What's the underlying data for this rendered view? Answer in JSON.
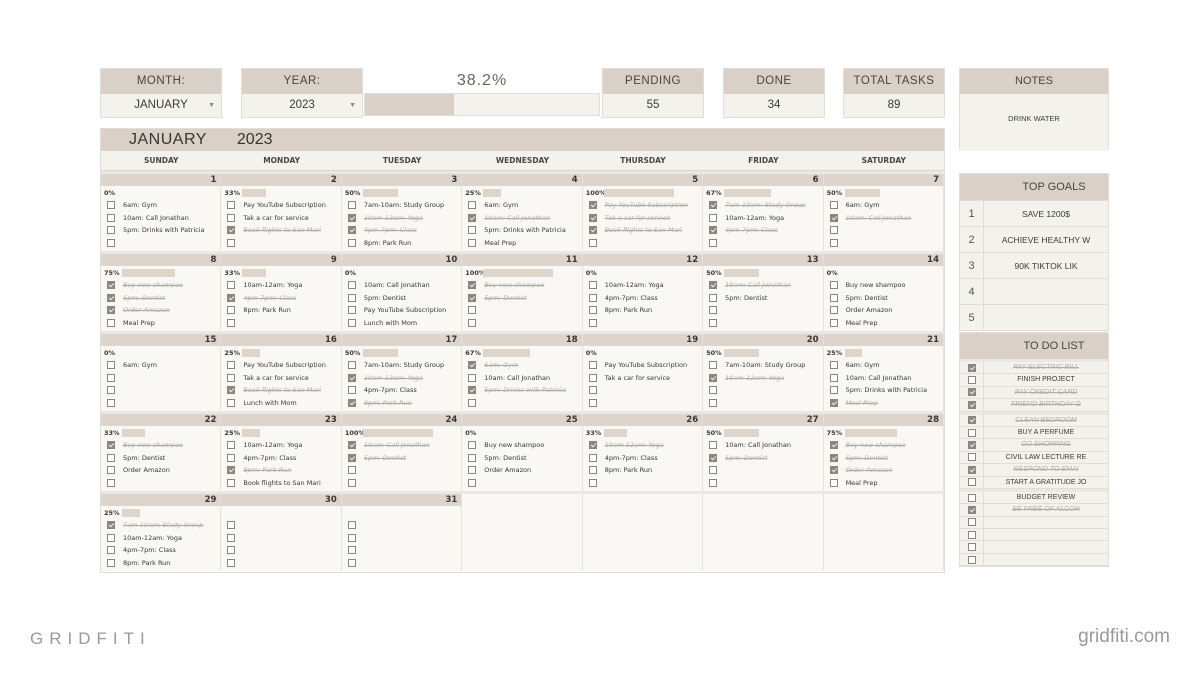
{
  "header": {
    "month_label": "MONTH:",
    "month_value": "JANUARY",
    "year_label": "YEAR:",
    "year_value": "2023",
    "progress_text": "38.2%",
    "progress_fraction": 0.382,
    "pending_label": "PENDING",
    "pending_value": "55",
    "done_label": "DONE",
    "done_value": "34",
    "total_label": "TOTAL TASKS",
    "total_value": "89"
  },
  "calendar": {
    "title_month": "JANUARY",
    "title_year": "2023",
    "weekdays": [
      "SUNDAY",
      "MONDAY",
      "TUESDAY",
      "WEDNESDAY",
      "THURSDAY",
      "FRIDAY",
      "SATURDAY"
    ],
    "days": [
      {
        "num": "1",
        "pct": "0%",
        "frac": 0,
        "tasks": [
          [
            "6am: Gym",
            0
          ],
          [
            "10am: Call Jonathan",
            0
          ],
          [
            "5pm: Drinks with Patricia",
            0
          ],
          [
            "",
            0
          ]
        ]
      },
      {
        "num": "2",
        "pct": "33%",
        "frac": 0.33,
        "tasks": [
          [
            "Pay YouTube Subscription",
            0
          ],
          [
            "Tak a car for service",
            0
          ],
          [
            "Book flights to San Mari",
            1
          ],
          [
            "",
            0
          ]
        ]
      },
      {
        "num": "3",
        "pct": "50%",
        "frac": 0.5,
        "tasks": [
          [
            "7am-10am: Study Group",
            0
          ],
          [
            "10am-12am: Yoga",
            1
          ],
          [
            "4pm-7pm: Class",
            1
          ],
          [
            "8pm: Park Run",
            0
          ]
        ]
      },
      {
        "num": "4",
        "pct": "25%",
        "frac": 0.25,
        "tasks": [
          [
            "6am: Gym",
            0
          ],
          [
            "10am: Call Jonathan",
            1
          ],
          [
            "5pm: Drinks with Patricia",
            0
          ],
          [
            "Meal Prep",
            0
          ]
        ]
      },
      {
        "num": "5",
        "pct": "100%",
        "frac": 1,
        "tasks": [
          [
            "Pay YouTube Subscription",
            1
          ],
          [
            "Tak a car for service",
            1
          ],
          [
            "Book flights to San Mari",
            1
          ],
          [
            "",
            0
          ]
        ]
      },
      {
        "num": "6",
        "pct": "67%",
        "frac": 0.67,
        "tasks": [
          [
            "7am-10am: Study Group",
            1
          ],
          [
            "10am-12am: Yoga",
            0
          ],
          [
            "4pm-7pm: Class",
            1
          ],
          [
            "",
            0
          ]
        ]
      },
      {
        "num": "7",
        "pct": "50%",
        "frac": 0.5,
        "tasks": [
          [
            "6am: Gym",
            0
          ],
          [
            "10am: Call Jonathan",
            1
          ],
          [
            "",
            0
          ],
          [
            "",
            0
          ]
        ]
      },
      {
        "num": "8",
        "pct": "75%",
        "frac": 0.75,
        "tasks": [
          [
            "Buy new shampoo",
            1
          ],
          [
            "5pm: Dentist",
            1
          ],
          [
            "Order Amazon",
            1
          ],
          [
            "Meal Prep",
            0
          ]
        ]
      },
      {
        "num": "9",
        "pct": "33%",
        "frac": 0.33,
        "tasks": [
          [
            "10am-12am: Yoga",
            0
          ],
          [
            "4pm-7pm: Class",
            1
          ],
          [
            "8pm: Park Run",
            0
          ],
          [
            "",
            0
          ]
        ]
      },
      {
        "num": "10",
        "pct": "0%",
        "frac": 0,
        "tasks": [
          [
            "10am: Call Jonathan",
            0
          ],
          [
            "5pm: Dentist",
            0
          ],
          [
            "Pay YouTube Subscription",
            0
          ],
          [
            "Lunch with Mom",
            0
          ]
        ]
      },
      {
        "num": "11",
        "pct": "100%",
        "frac": 1,
        "tasks": [
          [
            "Buy new shampoo",
            1
          ],
          [
            "5pm: Dentist",
            1
          ],
          [
            "",
            0
          ],
          [
            "",
            0
          ]
        ]
      },
      {
        "num": "12",
        "pct": "0%",
        "frac": 0,
        "tasks": [
          [
            "10am-12am: Yoga",
            0
          ],
          [
            "4pm-7pm: Class",
            0
          ],
          [
            "8pm: Park Run",
            0
          ],
          [
            "",
            0
          ]
        ]
      },
      {
        "num": "13",
        "pct": "50%",
        "frac": 0.5,
        "tasks": [
          [
            "10am: Call Jonathan",
            1
          ],
          [
            "5pm: Dentist",
            0
          ],
          [
            "",
            0
          ],
          [
            "",
            0
          ]
        ]
      },
      {
        "num": "14",
        "pct": "0%",
        "frac": 0,
        "tasks": [
          [
            "Buy new shampoo",
            0
          ],
          [
            "5pm: Dentist",
            0
          ],
          [
            "Order Amazon",
            0
          ],
          [
            "Meal Prep",
            0
          ]
        ]
      },
      {
        "num": "15",
        "pct": "0%",
        "frac": 0,
        "tasks": [
          [
            "6am: Gym",
            0
          ],
          [
            "",
            0
          ],
          [
            "",
            0
          ],
          [
            "",
            0
          ]
        ]
      },
      {
        "num": "16",
        "pct": "25%",
        "frac": 0.25,
        "tasks": [
          [
            "Pay YouTube Subscription",
            0
          ],
          [
            "Tak a car for service",
            0
          ],
          [
            "Book flights to San Mari",
            1
          ],
          [
            "Lunch with Mom",
            0
          ]
        ]
      },
      {
        "num": "17",
        "pct": "50%",
        "frac": 0.5,
        "tasks": [
          [
            "7am-10am: Study Group",
            0
          ],
          [
            "10am-12am: Yoga",
            1
          ],
          [
            "4pm-7pm: Class",
            0
          ],
          [
            "8pm: Park Run",
            1
          ]
        ]
      },
      {
        "num": "18",
        "pct": "67%",
        "frac": 0.67,
        "tasks": [
          [
            "6am: Gym",
            1
          ],
          [
            "10am: Call Jonathan",
            0
          ],
          [
            "5pm: Drinks with Patricia",
            1
          ],
          [
            "",
            0
          ]
        ]
      },
      {
        "num": "19",
        "pct": "0%",
        "frac": 0,
        "tasks": [
          [
            "Pay YouTube Subscription",
            0
          ],
          [
            "Tak a car for service",
            0
          ],
          [
            "",
            0
          ],
          [
            "",
            0
          ]
        ]
      },
      {
        "num": "20",
        "pct": "50%",
        "frac": 0.5,
        "tasks": [
          [
            "7am-10am: Study Group",
            0
          ],
          [
            "10am-12am: Yoga",
            1
          ],
          [
            "",
            0
          ],
          [
            "",
            0
          ]
        ]
      },
      {
        "num": "21",
        "pct": "25%",
        "frac": 0.25,
        "tasks": [
          [
            "6am: Gym",
            0
          ],
          [
            "10am: Call Jonathan",
            0
          ],
          [
            "5pm: Drinks with Patricia",
            0
          ],
          [
            "Meal Prep",
            1
          ]
        ]
      },
      {
        "num": "22",
        "pct": "33%",
        "frac": 0.33,
        "tasks": [
          [
            "Buy new shampoo",
            1
          ],
          [
            "5pm: Dentist",
            0
          ],
          [
            "Order Amazon",
            0
          ],
          [
            "",
            0
          ]
        ]
      },
      {
        "num": "23",
        "pct": "25%",
        "frac": 0.25,
        "tasks": [
          [
            "10am-12am: Yoga",
            0
          ],
          [
            "4pm-7pm: Class",
            0
          ],
          [
            "8pm: Park Run",
            1
          ],
          [
            "Book flights to San Mari",
            0
          ]
        ]
      },
      {
        "num": "24",
        "pct": "100%",
        "frac": 1,
        "tasks": [
          [
            "10am: Call Jonathan",
            1
          ],
          [
            "5pm: Dentist",
            1
          ],
          [
            "",
            0
          ],
          [
            "",
            0
          ]
        ]
      },
      {
        "num": "25",
        "pct": "0%",
        "frac": 0,
        "tasks": [
          [
            "Buy new shampoo",
            0
          ],
          [
            "5pm: Dentist",
            0
          ],
          [
            "Order Amazon",
            0
          ],
          [
            "",
            0
          ]
        ]
      },
      {
        "num": "26",
        "pct": "33%",
        "frac": 0.33,
        "tasks": [
          [
            "10am-12am: Yoga",
            1
          ],
          [
            "4pm-7pm: Class",
            0
          ],
          [
            "8pm: Park Run",
            0
          ],
          [
            "",
            0
          ]
        ]
      },
      {
        "num": "27",
        "pct": "50%",
        "frac": 0.5,
        "tasks": [
          [
            "10am: Call Jonathan",
            0
          ],
          [
            "5pm: Dentist",
            1
          ],
          [
            "",
            0
          ],
          [
            "",
            0
          ]
        ]
      },
      {
        "num": "28",
        "pct": "75%",
        "frac": 0.75,
        "tasks": [
          [
            "Buy new shampoo",
            1
          ],
          [
            "5pm: Dentist",
            1
          ],
          [
            "Order Amazon",
            1
          ],
          [
            "Meal Prep",
            0
          ]
        ]
      },
      {
        "num": "29",
        "pct": "25%",
        "frac": 0.25,
        "tasks": [
          [
            "7am-10am: Study Group",
            1
          ],
          [
            "10am-12am: Yoga",
            0
          ],
          [
            "4pm-7pm: Class",
            0
          ],
          [
            "8pm: Park Run",
            0
          ]
        ]
      },
      {
        "num": "30",
        "pct": "",
        "frac": 0,
        "tasks": [
          [
            "",
            0
          ],
          [
            "",
            0
          ],
          [
            "",
            0
          ],
          [
            "",
            0
          ]
        ]
      },
      {
        "num": "31",
        "pct": "",
        "frac": 0,
        "tasks": [
          [
            "",
            0
          ],
          [
            "",
            0
          ],
          [
            "",
            0
          ],
          [
            "",
            0
          ]
        ]
      }
    ]
  },
  "notes": {
    "label": "NOTES",
    "text": "DRINK WATER"
  },
  "goals": {
    "label": "TOP GOALS",
    "items": [
      {
        "n": "1",
        "text": "SAVE 1200$"
      },
      {
        "n": "2",
        "text": "ACHIEVE HEALTHY W"
      },
      {
        "n": "3",
        "text": "90K TIKTOK LIK"
      },
      {
        "n": "4",
        "text": ""
      },
      {
        "n": "5",
        "text": ""
      }
    ]
  },
  "todo": {
    "label": "TO DO LIST",
    "groups": [
      [
        [
          "PAY ELECTRIC BILL",
          1
        ],
        [
          "FINISH PROJECT",
          0
        ],
        [
          "PAY CREDIT CARD",
          1
        ],
        [
          "FRIEND BIRTHDAY G",
          1
        ]
      ],
      [
        [
          "CLEAN BEDROOM",
          1
        ],
        [
          "BUY A PERFUME",
          0
        ],
        [
          "GO SHOPPING",
          1
        ],
        [
          "CIVIL LAW LECTURE RE",
          0
        ],
        [
          "RESPOND TO EMAI",
          1
        ],
        [
          "START A GRATITUDE JO",
          0
        ]
      ],
      [
        [
          "BUDGET REVIEW",
          0
        ],
        [
          "BE FREE OF ALCOH",
          1
        ],
        [
          "",
          0
        ],
        [
          "",
          0
        ],
        [
          "",
          0
        ],
        [
          "",
          0
        ]
      ]
    ]
  },
  "branding": {
    "left": "GRIDFITI",
    "right": "gridfiti.com"
  }
}
